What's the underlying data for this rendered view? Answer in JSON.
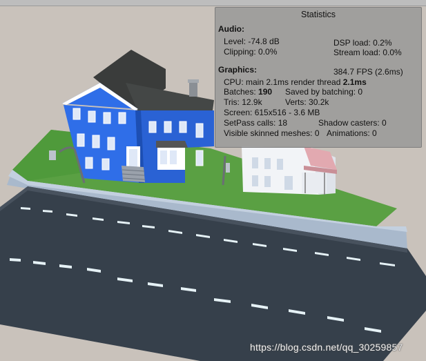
{
  "statistics": {
    "title": "Statistics",
    "audio": {
      "heading": "Audio:",
      "level": "Level: -74.8 dB",
      "clipping": "Clipping: 0.0%",
      "dsp_load": "DSP load: 0.2%",
      "stream_load": "Stream load: 0.0%"
    },
    "graphics": {
      "heading": "Graphics:",
      "fps": "384.7 FPS (2.6ms)",
      "cpu_prefix": "CPU: main 2.1ms  render thread ",
      "cpu_render": "2.1ms",
      "batches_label": "Batches: ",
      "batches_value": "190",
      "saved_batching": "Saved by batching: 0",
      "tris": "Tris: 12.9k",
      "verts": "Verts: 30.2k",
      "screen": "Screen: 615x516 - 3.6 MB",
      "setpass": "SetPass calls: 18",
      "shadow_casters": "Shadow casters: 0",
      "skinned_meshes": "Visible skinned meshes: 0",
      "animations": "Animations: 0"
    }
  },
  "watermark": "https://blog.csdn.net/qq_30259857",
  "colors": {
    "background": "#c9c2bb",
    "grass": "#5aa043",
    "road": "#36404b",
    "sidewalk": "#a9b9cc",
    "blue_house": "#2f6ee8",
    "white_house": "#f2f4f7",
    "roof_dark": "#3a3c3b",
    "roof_pink": "#e2a9b0"
  }
}
